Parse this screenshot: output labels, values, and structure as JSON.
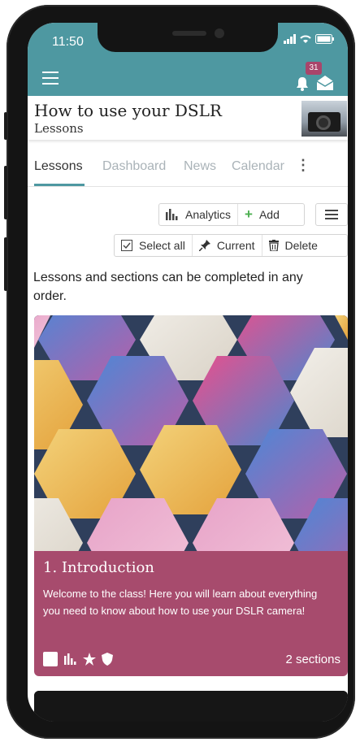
{
  "status_bar": {
    "time": "11:50"
  },
  "app_bar": {
    "notification_count": "31"
  },
  "course": {
    "title": "How to use your DSLR",
    "subtitle": "Lessons"
  },
  "tabs": [
    {
      "label": "Lessons",
      "active": true
    },
    {
      "label": "Dashboard",
      "active": false
    },
    {
      "label": "News",
      "active": false
    },
    {
      "label": "Calendar",
      "active": false
    }
  ],
  "toolbar": {
    "analytics_label": "Analytics",
    "add_label": "Add",
    "select_all_label": "Select all",
    "current_label": "Current",
    "delete_label": "Delete"
  },
  "intro_text": "Lessons and sections can be completed in any order.",
  "lessons": [
    {
      "title": "1. Introduction",
      "description": "Welcome to the class! Here you will learn about everything you need to know about how to use your DSLR camera!",
      "sections": "2 sections"
    }
  ],
  "colors": {
    "brand": "#4e98a1",
    "card": "#a74b6d",
    "badge": "#a9456b"
  }
}
